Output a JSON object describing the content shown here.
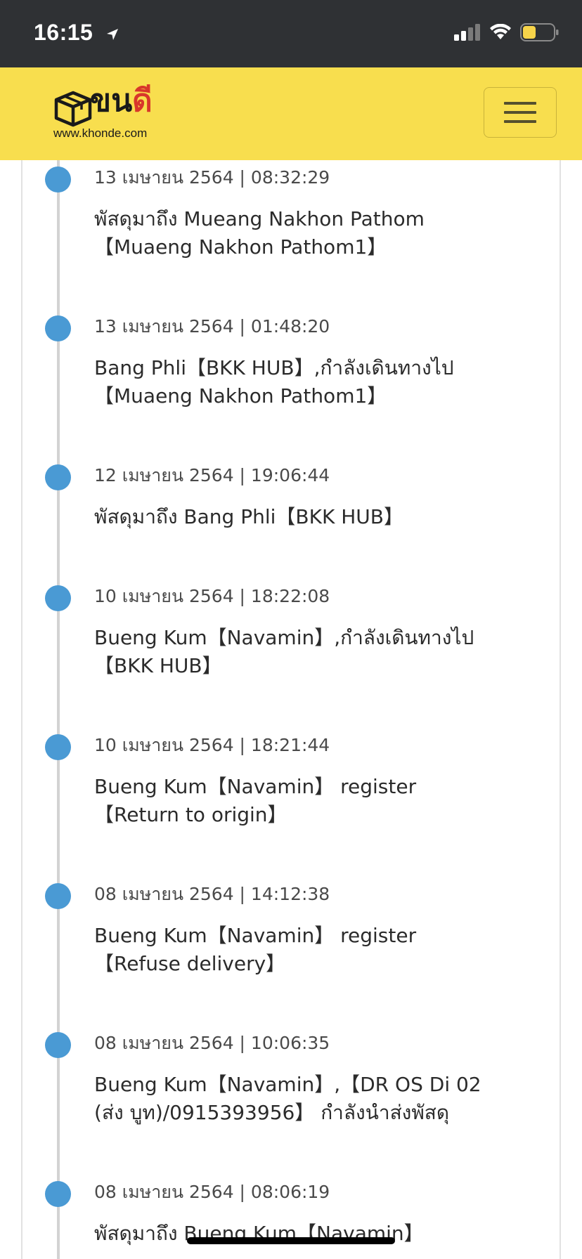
{
  "status_bar": {
    "time": "16:15",
    "icons": [
      "location-arrow-icon",
      "cellular-signal-icon",
      "wifi-icon",
      "battery-icon"
    ],
    "battery_color": "#f7d44a"
  },
  "navbar": {
    "brand_text_primary": "ขน",
    "brand_text_accent": "ดี",
    "brand_url": "www.khonde.com",
    "menu_icon": "hamburger-icon",
    "background": "#f8de4e",
    "accent": "#d8372b"
  },
  "timeline": {
    "dot_color": "#4a9ad4",
    "events": [
      {
        "time": "13 เมษายน 2564 | 08:32:29",
        "lines": [
          "พัสดุมาถึง Mueang Nakhon Pathom",
          "【Muaeng Nakhon Pathom1】"
        ]
      },
      {
        "time": "13 เมษายน 2564 | 01:48:20",
        "lines": [
          "Bang Phli【BKK HUB】,กำลังเดินทางไป",
          "【Muaeng Nakhon Pathom1】"
        ]
      },
      {
        "time": "12 เมษายน 2564 | 19:06:44",
        "lines": [
          "พัสดุมาถึง Bang Phli【BKK HUB】"
        ]
      },
      {
        "time": "10 เมษายน 2564 | 18:22:08",
        "lines": [
          "Bueng Kum【Navamin】,กำลังเดินทางไป",
          "【BKK HUB】"
        ]
      },
      {
        "time": "10 เมษายน 2564 | 18:21:44",
        "lines": [
          "Bueng Kum【Navamin】 register",
          "【Return to origin】"
        ]
      },
      {
        "time": "08 เมษายน 2564 | 14:12:38",
        "lines": [
          "Bueng Kum【Navamin】 register",
          "【Refuse delivery】"
        ]
      },
      {
        "time": "08 เมษายน 2564 | 10:06:35",
        "lines": [
          "Bueng Kum【Navamin】,【DR OS Di 02",
          "(ส่ง บูท)/0915393956】 กำลังนำส่งพัสดุ"
        ]
      },
      {
        "time": "08 เมษายน 2564 | 08:06:19",
        "lines": [
          "พัสดุมาถึง Bueng Kum【Navamin】"
        ]
      }
    ]
  }
}
